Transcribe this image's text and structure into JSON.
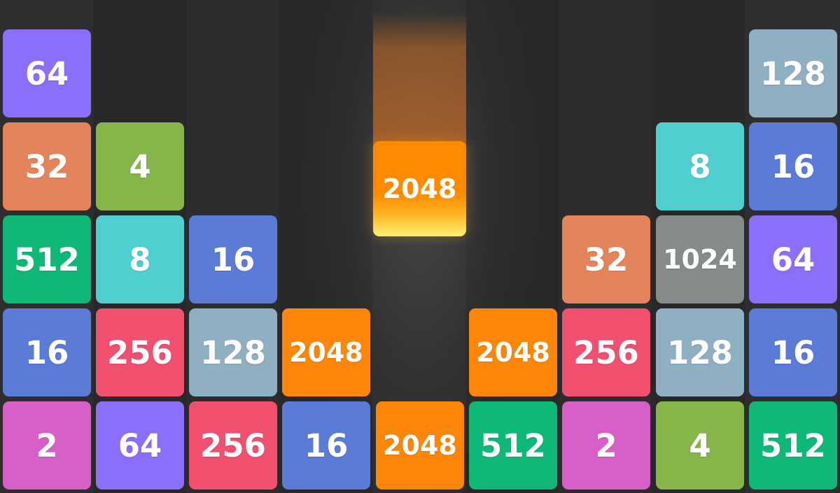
{
  "columns": [
    {
      "tiles": [
        {
          "value": "2",
          "color": "#d85fc8"
        },
        {
          "value": "16",
          "color": "#5b7bd8"
        },
        {
          "value": "512",
          "color": "#10b877"
        },
        {
          "value": "32",
          "color": "#e5845b"
        },
        {
          "value": "64",
          "color": "#8b6ffa"
        }
      ]
    },
    {
      "tiles": [
        {
          "value": "64",
          "color": "#8b6ffa"
        },
        {
          "value": "256",
          "color": "#f1506f"
        },
        {
          "value": "8",
          "color": "#4fcfcf"
        },
        {
          "value": "4",
          "color": "#86b64a"
        }
      ]
    },
    {
      "tiles": [
        {
          "value": "256",
          "color": "#f1506f"
        },
        {
          "value": "128",
          "color": "#8fb0c3"
        },
        {
          "value": "16",
          "color": "#5b7bd8"
        }
      ]
    },
    {
      "tiles": [
        {
          "value": "16",
          "color": "#5b7bd8"
        },
        {
          "value": "2048",
          "color": "#fe8608"
        }
      ]
    },
    {
      "tiles": [
        {
          "value": "2048",
          "color": "#fe8608"
        }
      ]
    },
    {
      "tiles": [
        {
          "value": "512",
          "color": "#10b877"
        },
        {
          "value": "2048",
          "color": "#fe8608"
        }
      ]
    },
    {
      "tiles": [
        {
          "value": "2",
          "color": "#d85fc8"
        },
        {
          "value": "256",
          "color": "#f1506f"
        },
        {
          "value": "32",
          "color": "#e5845b"
        }
      ]
    },
    {
      "tiles": [
        {
          "value": "4",
          "color": "#86b64a"
        },
        {
          "value": "128",
          "color": "#8fb0c3"
        },
        {
          "value": "1024",
          "color": "#858c8a"
        },
        {
          "value": "8",
          "color": "#4fcfcf"
        }
      ]
    },
    {
      "tiles": [
        {
          "value": "512",
          "color": "#10b877"
        },
        {
          "value": "16",
          "color": "#5b7bd8"
        },
        {
          "value": "64",
          "color": "#8b6ffa"
        },
        {
          "value": "16",
          "color": "#5b7bd8"
        },
        {
          "value": "128",
          "color": "#8fb0c3"
        }
      ]
    }
  ],
  "falling_tile": {
    "value": "2048",
    "color": "#fe8608",
    "column": 5
  },
  "column_shades": [
    "#2e2e2e",
    "#282828",
    "#2c2c2c",
    "#282828",
    "#2e2e2e",
    "#282828",
    "#2c2c2c",
    "#282828",
    "#2e2e2e"
  ]
}
